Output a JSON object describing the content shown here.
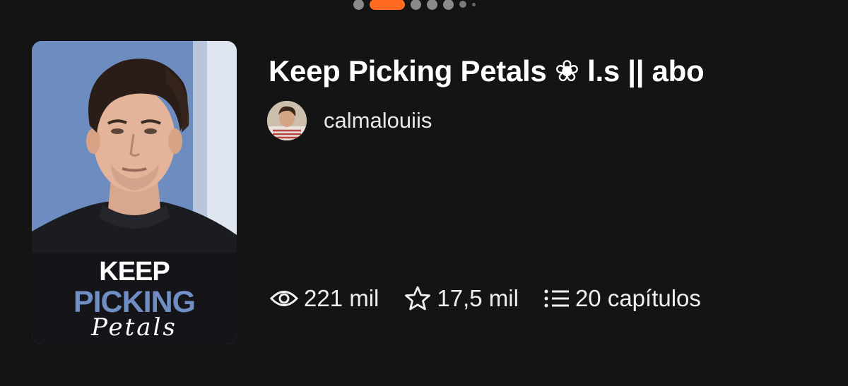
{
  "pager": {
    "total_dots": 8,
    "active_index": 1
  },
  "story": {
    "title": "Keep Picking Petals ❀ l.s || abo",
    "cover_text": {
      "line1": "KEEP",
      "line2": "PICKING",
      "line3": "Petals"
    }
  },
  "author": {
    "name": "calmalouiis"
  },
  "stats": {
    "reads": "221 mil",
    "votes": "17,5 mil",
    "parts": "20 capítulos"
  },
  "icons": {
    "reads": "eye-icon",
    "votes": "star-icon",
    "parts": "list-icon"
  },
  "colors": {
    "background": "#141414",
    "accent": "#ff6a20",
    "cover_blue": "#6f8fc4"
  }
}
